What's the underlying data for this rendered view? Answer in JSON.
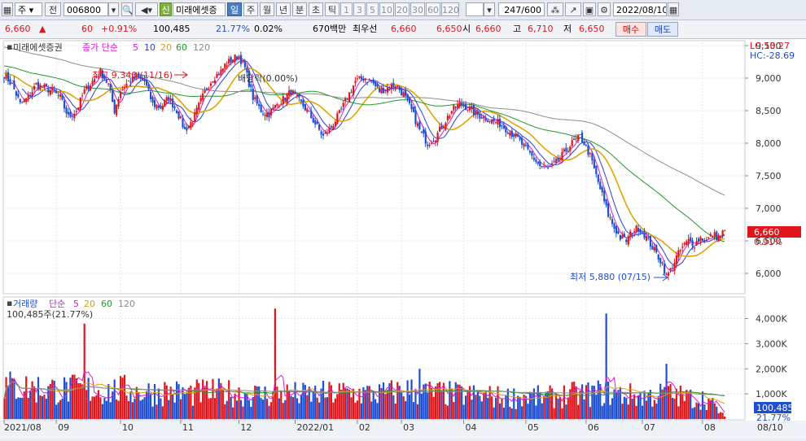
{
  "toolbar": {
    "market": "주",
    "prev_label": "전",
    "code": "006800",
    "sin_badge": "신",
    "stock_name": "미래에셋증",
    "periods": [
      "일",
      "주",
      "월",
      "년",
      "분",
      "초",
      "틱"
    ],
    "active_period": "일",
    "minutes": [
      "1",
      "3",
      "5",
      "10",
      "20",
      "30",
      "60",
      "120"
    ],
    "count": "247/600",
    "date": "2022/08/10"
  },
  "quote": {
    "price": "6,660",
    "change": "60",
    "change_pct": "+0.91%",
    "volume": "100,485",
    "volume_ratio": "21.77%",
    "turnover": "0.02%",
    "trade_value": "670백만",
    "best_ask_label": "최우선",
    "best_ask": "6,660",
    "best_bid": "6,650",
    "open_label": "시",
    "open": "6,660",
    "high_label": "고",
    "high": "6,710",
    "low_label": "저",
    "low": "6,650",
    "buy_label": "매수",
    "sell_label": "매도"
  },
  "price_panel": {
    "stock": "미래에셋증권",
    "ma_label": "종가 단순",
    "ma_periods": [
      "5",
      "10",
      "20",
      "60",
      "120"
    ],
    "lc_label": "LC:13.27",
    "hc_label": "HC:-28.69",
    "high_annot": "최고 9,340 (11/16)",
    "low_annot": "최저 5,880 (07/15)",
    "dividend_annot": "배당락(0.00%)",
    "last_price_tag": "6,660",
    "last_pct_tag": "0.91%"
  },
  "volume_panel": {
    "title": "거래량",
    "ma_label": "단순",
    "ma_periods": [
      "5",
      "20",
      "60",
      "120"
    ],
    "current": "100,485주(21.77%)",
    "last_tag": "100,485",
    "last_pct": "21.77%"
  },
  "colors": {
    "up": "#e0161c",
    "down": "#1f4fd1",
    "ma5": "#d81ad8",
    "ma10": "#2b3fd6",
    "ma20": "#e0a400",
    "ma60": "#1f9a2a",
    "ma120": "#8c8c8c"
  },
  "chart_data": {
    "type": "candlestick",
    "price_axis": {
      "min": 5700,
      "max": 9550,
      "ticks": [
        6000,
        6500,
        7000,
        7500,
        8000,
        8500,
        9000,
        9500
      ]
    },
    "volume_axis": {
      "min": 0,
      "max": 4600000,
      "ticks": [
        1000000,
        2000000,
        3000000,
        4000000
      ],
      "tick_labels": [
        "1,000K",
        "2,000K",
        "3,000K",
        "4,000K"
      ]
    },
    "x_labels": [
      "2021/08",
      "09",
      "10",
      "11",
      "12",
      "2022/01",
      "02",
      "03",
      "04",
      "05",
      "06",
      "07",
      "08"
    ],
    "last_date_label": "08/10",
    "price_path": [
      [
        0,
        9050
      ],
      [
        4,
        8900
      ],
      [
        8,
        8600
      ],
      [
        12,
        8700
      ],
      [
        16,
        8900
      ],
      [
        20,
        8850
      ],
      [
        24,
        8800
      ],
      [
        28,
        8700
      ],
      [
        32,
        8400
      ],
      [
        36,
        8500
      ],
      [
        40,
        8800
      ],
      [
        44,
        8950
      ],
      [
        48,
        9100
      ],
      [
        52,
        8900
      ],
      [
        55,
        8500
      ],
      [
        58,
        8800
      ],
      [
        62,
        8950
      ],
      [
        66,
        9000
      ],
      [
        70,
        8950
      ],
      [
        74,
        8600
      ],
      [
        78,
        8550
      ],
      [
        82,
        8700
      ],
      [
        86,
        8500
      ],
      [
        90,
        8200
      ],
      [
        94,
        8350
      ],
      [
        98,
        8650
      ],
      [
        101,
        8850
      ],
      [
        104,
        9000
      ],
      [
        108,
        9100
      ],
      [
        110,
        9200
      ],
      [
        114,
        9300
      ],
      [
        117,
        9340
      ],
      [
        120,
        9150
      ],
      [
        124,
        8700
      ],
      [
        128,
        8500
      ],
      [
        132,
        8450
      ],
      [
        136,
        8600
      ],
      [
        140,
        8700
      ],
      [
        143,
        8800
      ],
      [
        147,
        8650
      ],
      [
        151,
        8500
      ],
      [
        155,
        8300
      ],
      [
        159,
        8100
      ],
      [
        163,
        8250
      ],
      [
        167,
        8450
      ],
      [
        171,
        8700
      ],
      [
        175,
        8950
      ],
      [
        179,
        9000
      ],
      [
        183,
        8950
      ],
      [
        187,
        8800
      ],
      [
        191,
        8850
      ],
      [
        195,
        8900
      ],
      [
        199,
        8750
      ],
      [
        203,
        8500
      ],
      [
        207,
        8200
      ],
      [
        211,
        8000
      ],
      [
        215,
        8100
      ],
      [
        219,
        8300
      ],
      [
        223,
        8500
      ],
      [
        227,
        8600
      ],
      [
        231,
        8550
      ],
      [
        235,
        8450
      ],
      [
        239,
        8400
      ],
      [
        243,
        8350
      ],
      [
        247,
        8300
      ],
      [
        251,
        8200
      ],
      [
        255,
        8100
      ],
      [
        259,
        7950
      ],
      [
        263,
        7800
      ],
      [
        267,
        7650
      ],
      [
        271,
        7600
      ],
      [
        275,
        7700
      ],
      [
        279,
        7850
      ],
      [
        283,
        8000
      ],
      [
        287,
        8100
      ],
      [
        289,
        8000
      ],
      [
        292,
        7800
      ],
      [
        295,
        7500
      ],
      [
        298,
        7200
      ],
      [
        301,
        6900
      ],
      [
        304,
        6700
      ],
      [
        307,
        6550
      ],
      [
        310,
        6500
      ],
      [
        313,
        6650
      ],
      [
        316,
        6700
      ],
      [
        319,
        6600
      ],
      [
        322,
        6450
      ],
      [
        325,
        6300
      ],
      [
        328,
        6150
      ],
      [
        330,
        5950
      ],
      [
        332,
        6050
      ],
      [
        335,
        6250
      ],
      [
        338,
        6400
      ],
      [
        341,
        6500
      ],
      [
        344,
        6450
      ],
      [
        347,
        6550
      ],
      [
        350,
        6500
      ],
      [
        353,
        6600
      ],
      [
        356,
        6550
      ],
      [
        359,
        6660
      ]
    ],
    "volume_path": [
      [
        0,
        1300000
      ],
      [
        10,
        1250000
      ],
      [
        20,
        1200000
      ],
      [
        30,
        1150000
      ],
      [
        40,
        1200000
      ],
      [
        50,
        1100000
      ],
      [
        60,
        1150000
      ],
      [
        70,
        1050000
      ],
      [
        80,
        1100000
      ],
      [
        90,
        1000000
      ],
      [
        100,
        1050000
      ],
      [
        110,
        1050000
      ],
      [
        120,
        1000000
      ],
      [
        130,
        950000
      ],
      [
        140,
        1000000
      ],
      [
        150,
        950000
      ],
      [
        160,
        1000000
      ],
      [
        170,
        1050000
      ],
      [
        180,
        1000000
      ],
      [
        190,
        1000000
      ],
      [
        200,
        1150000
      ],
      [
        210,
        1050000
      ],
      [
        220,
        1000000
      ],
      [
        230,
        950000
      ],
      [
        240,
        900000
      ],
      [
        250,
        850000
      ],
      [
        260,
        900000
      ],
      [
        270,
        850000
      ],
      [
        280,
        950000
      ],
      [
        290,
        1000000
      ],
      [
        300,
        1050000
      ],
      [
        310,
        950000
      ],
      [
        320,
        900000
      ],
      [
        330,
        1000000
      ],
      [
        340,
        850000
      ],
      [
        350,
        800000
      ],
      [
        359,
        100485
      ]
    ],
    "volume_spikes": [
      [
        40,
        3800000
      ],
      [
        135,
        4400000
      ],
      [
        207,
        2000000
      ],
      [
        300,
        4200000
      ],
      [
        330,
        2200000
      ]
    ]
  }
}
